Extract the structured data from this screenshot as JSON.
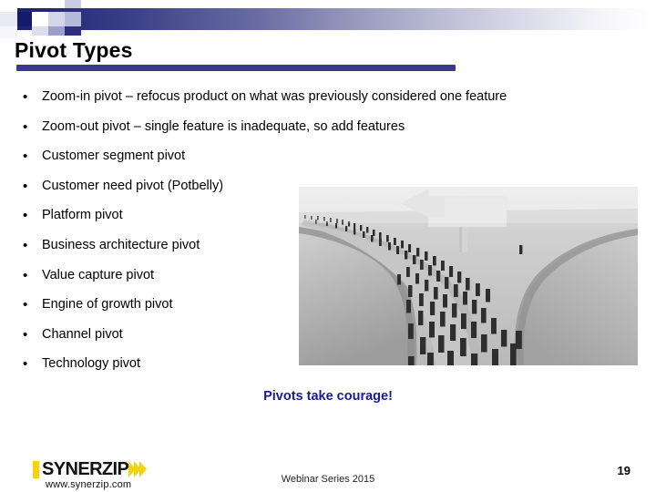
{
  "slide": {
    "title": "Pivot Types",
    "accent_color": "#3a3a8c",
    "caption_color": "#1a1a8c",
    "logo_color": "#f5d312"
  },
  "bullets": [
    {
      "marker": "•",
      "text": "Zoom-in pivot – refocus product on what was previously considered one feature"
    },
    {
      "marker": "•",
      "text": "Zoom-out pivot – single feature is inadequate, so add features"
    },
    {
      "marker": "•",
      "text": "Customer segment pivot"
    },
    {
      "marker": "•",
      "text": "Customer need pivot (Potbelly)"
    },
    {
      "marker": "•",
      "text": "Platform pivot"
    },
    {
      "marker": "•",
      "text": "Business architecture pivot"
    },
    {
      "marker": "•",
      "text": "Value capture pivot"
    },
    {
      "marker": "•",
      "text": "Engine of growth pivot"
    },
    {
      "marker": "•",
      "text": "Channel pivot"
    },
    {
      "marker": "•",
      "text": "Technology pivot"
    }
  ],
  "photo": {
    "alt": "Grayscale photo of a large crowd of people walking along a forked road, with a big arrow sign pointing left while one lone person walks off to the right"
  },
  "caption": "Pivots take courage!",
  "footer": {
    "logo_text": "SYNERZIP",
    "logo_url": "www.synerzip.com",
    "center_text": "Webinar Series 2015",
    "page_number": "19"
  }
}
